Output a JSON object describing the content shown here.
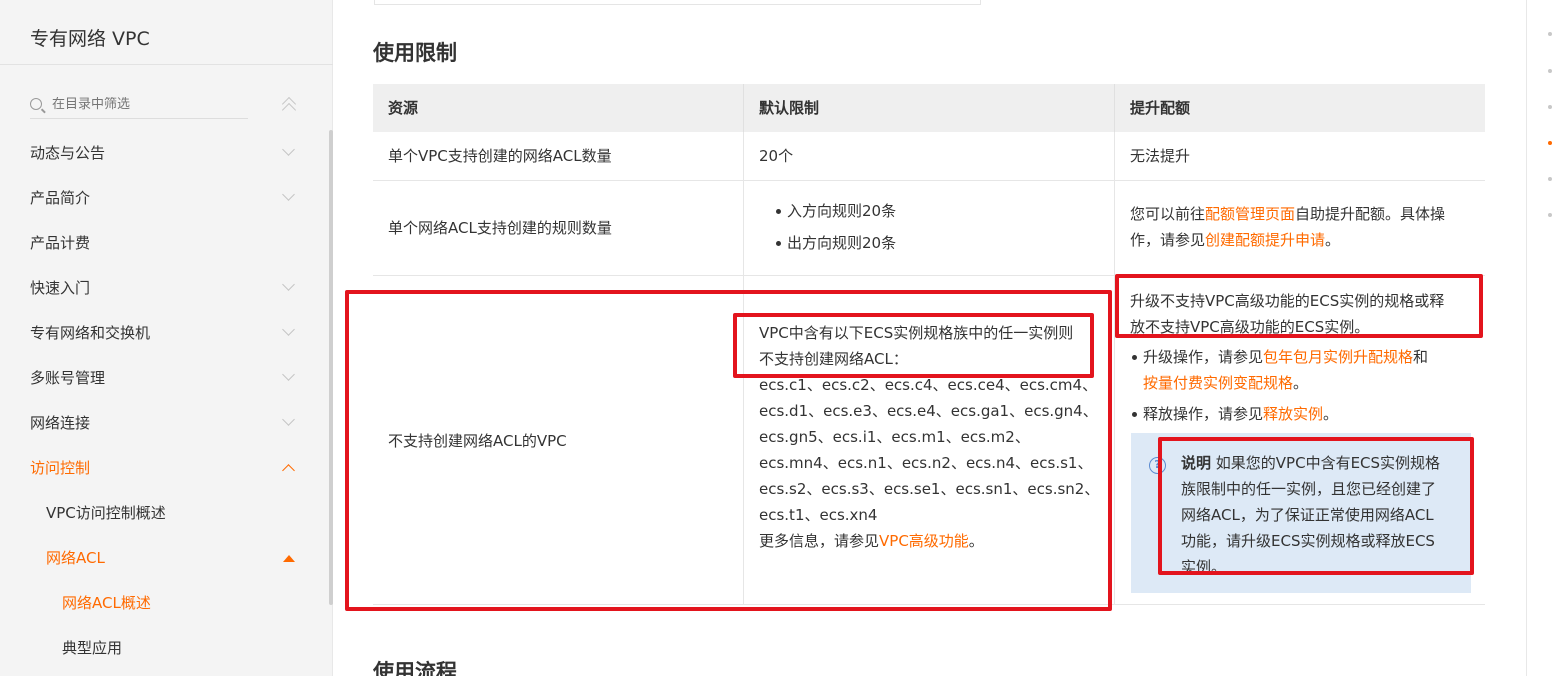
{
  "sidebar": {
    "title": "专有网络 VPC",
    "search_placeholder": "在目录中筛选",
    "items": [
      {
        "label": "动态与公告"
      },
      {
        "label": "产品简介"
      },
      {
        "label": "产品计费"
      },
      {
        "label": "快速入门"
      },
      {
        "label": "专有网络和交换机"
      },
      {
        "label": "多账号管理"
      },
      {
        "label": "网络连接"
      },
      {
        "label": "访问控制"
      },
      {
        "label": "VPC访问控制概述"
      },
      {
        "label": "网络ACL"
      },
      {
        "label": "网络ACL概述"
      },
      {
        "label": "典型应用"
      }
    ]
  },
  "main": {
    "section_title": "使用限制",
    "next_section_title": "使用流程",
    "table": {
      "headers": [
        "资源",
        "默认限制",
        "提升配额"
      ],
      "row1": {
        "resource": "单个VPC支持创建的网络ACL数量",
        "limit": "20个",
        "quota": "无法提升"
      },
      "row2": {
        "resource": "单个网络ACL支持创建的规则数量",
        "limit_items": [
          "入方向规则20条",
          "出方向规则20条"
        ],
        "quota_prefix": "您可以前往",
        "quota_link1": "配额管理页面",
        "quota_mid": "自助提升配额。具体操",
        "quota_mid2": "作，请参见",
        "quota_link2": "创建配额提升申请",
        "quota_suffix": "。"
      },
      "row3": {
        "resource": "不支持创建网络ACL的VPC",
        "limit_lines": [
          "VPC中含有以下ECS实例规格族中的任一实例则",
          "不支持创建网络ACL：",
          "ecs.c1、ecs.c2、ecs.c4、ecs.ce4、ecs.cm4、",
          "ecs.d1、ecs.e3、ecs.e4、ecs.ga1、ecs.gn4、",
          "ecs.gn5、ecs.i1、ecs.m1、ecs.m2、",
          "ecs.mn4、ecs.n1、ecs.n2、ecs.n4、ecs.s1、",
          "ecs.s2、ecs.s3、ecs.se1、ecs.sn1、ecs.sn2、",
          "ecs.t1、ecs.xn4"
        ],
        "more_prefix": "更多信息，请参见",
        "more_link": "VPC高级功能",
        "more_suffix": "。",
        "quota_lines": [
          "升级不支持VPC高级功能的ECS实例的规格或释",
          "放不支持VPC高级功能的ECS实例。"
        ],
        "bullet1_prefix": "升级操作，请参见",
        "bullet1_link": "包年包月实例升配规格",
        "bullet1_and": "和",
        "bullet1_link2": "按量付费实例变配规格",
        "bullet1_suffix": "。",
        "bullet2_prefix": "释放操作，请参见",
        "bullet2_link": "释放实例",
        "bullet2_suffix": "。",
        "note_label": "说明",
        "note_lines": [
          "如果您的VPC中含有ECS实例规格",
          "族限制中的任一实例，且您已经创建了",
          "网络ACL，为了保证正常使用网络ACL",
          "功能，请升级ECS实例规格或释放ECS",
          "实例。"
        ]
      }
    }
  },
  "colors": {
    "accent": "#ff6a00",
    "highlight": "#e3141d",
    "note_bg": "#dde9f6"
  }
}
